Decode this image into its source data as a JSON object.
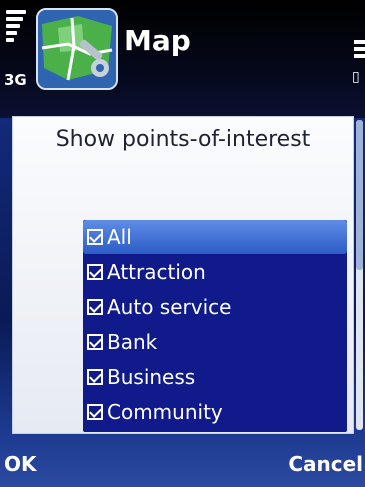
{
  "status": {
    "network": "3G",
    "signal_bars": 5,
    "battery_bars": 3
  },
  "app": {
    "title": "Map",
    "icon": "map-wrench-icon"
  },
  "dialog": {
    "title": "Show points-of-interest",
    "items": [
      {
        "label": "All",
        "checked": true,
        "selected": true
      },
      {
        "label": "Attraction",
        "checked": true,
        "selected": false
      },
      {
        "label": "Auto service",
        "checked": true,
        "selected": false
      },
      {
        "label": "Bank",
        "checked": true,
        "selected": false
      },
      {
        "label": "Business",
        "checked": true,
        "selected": false
      },
      {
        "label": "Community",
        "checked": true,
        "selected": false
      }
    ]
  },
  "softkeys": {
    "left": "OK",
    "right": "Cancel"
  },
  "colors": {
    "list_background": "#101a8a",
    "highlight": "#4a78d8"
  }
}
